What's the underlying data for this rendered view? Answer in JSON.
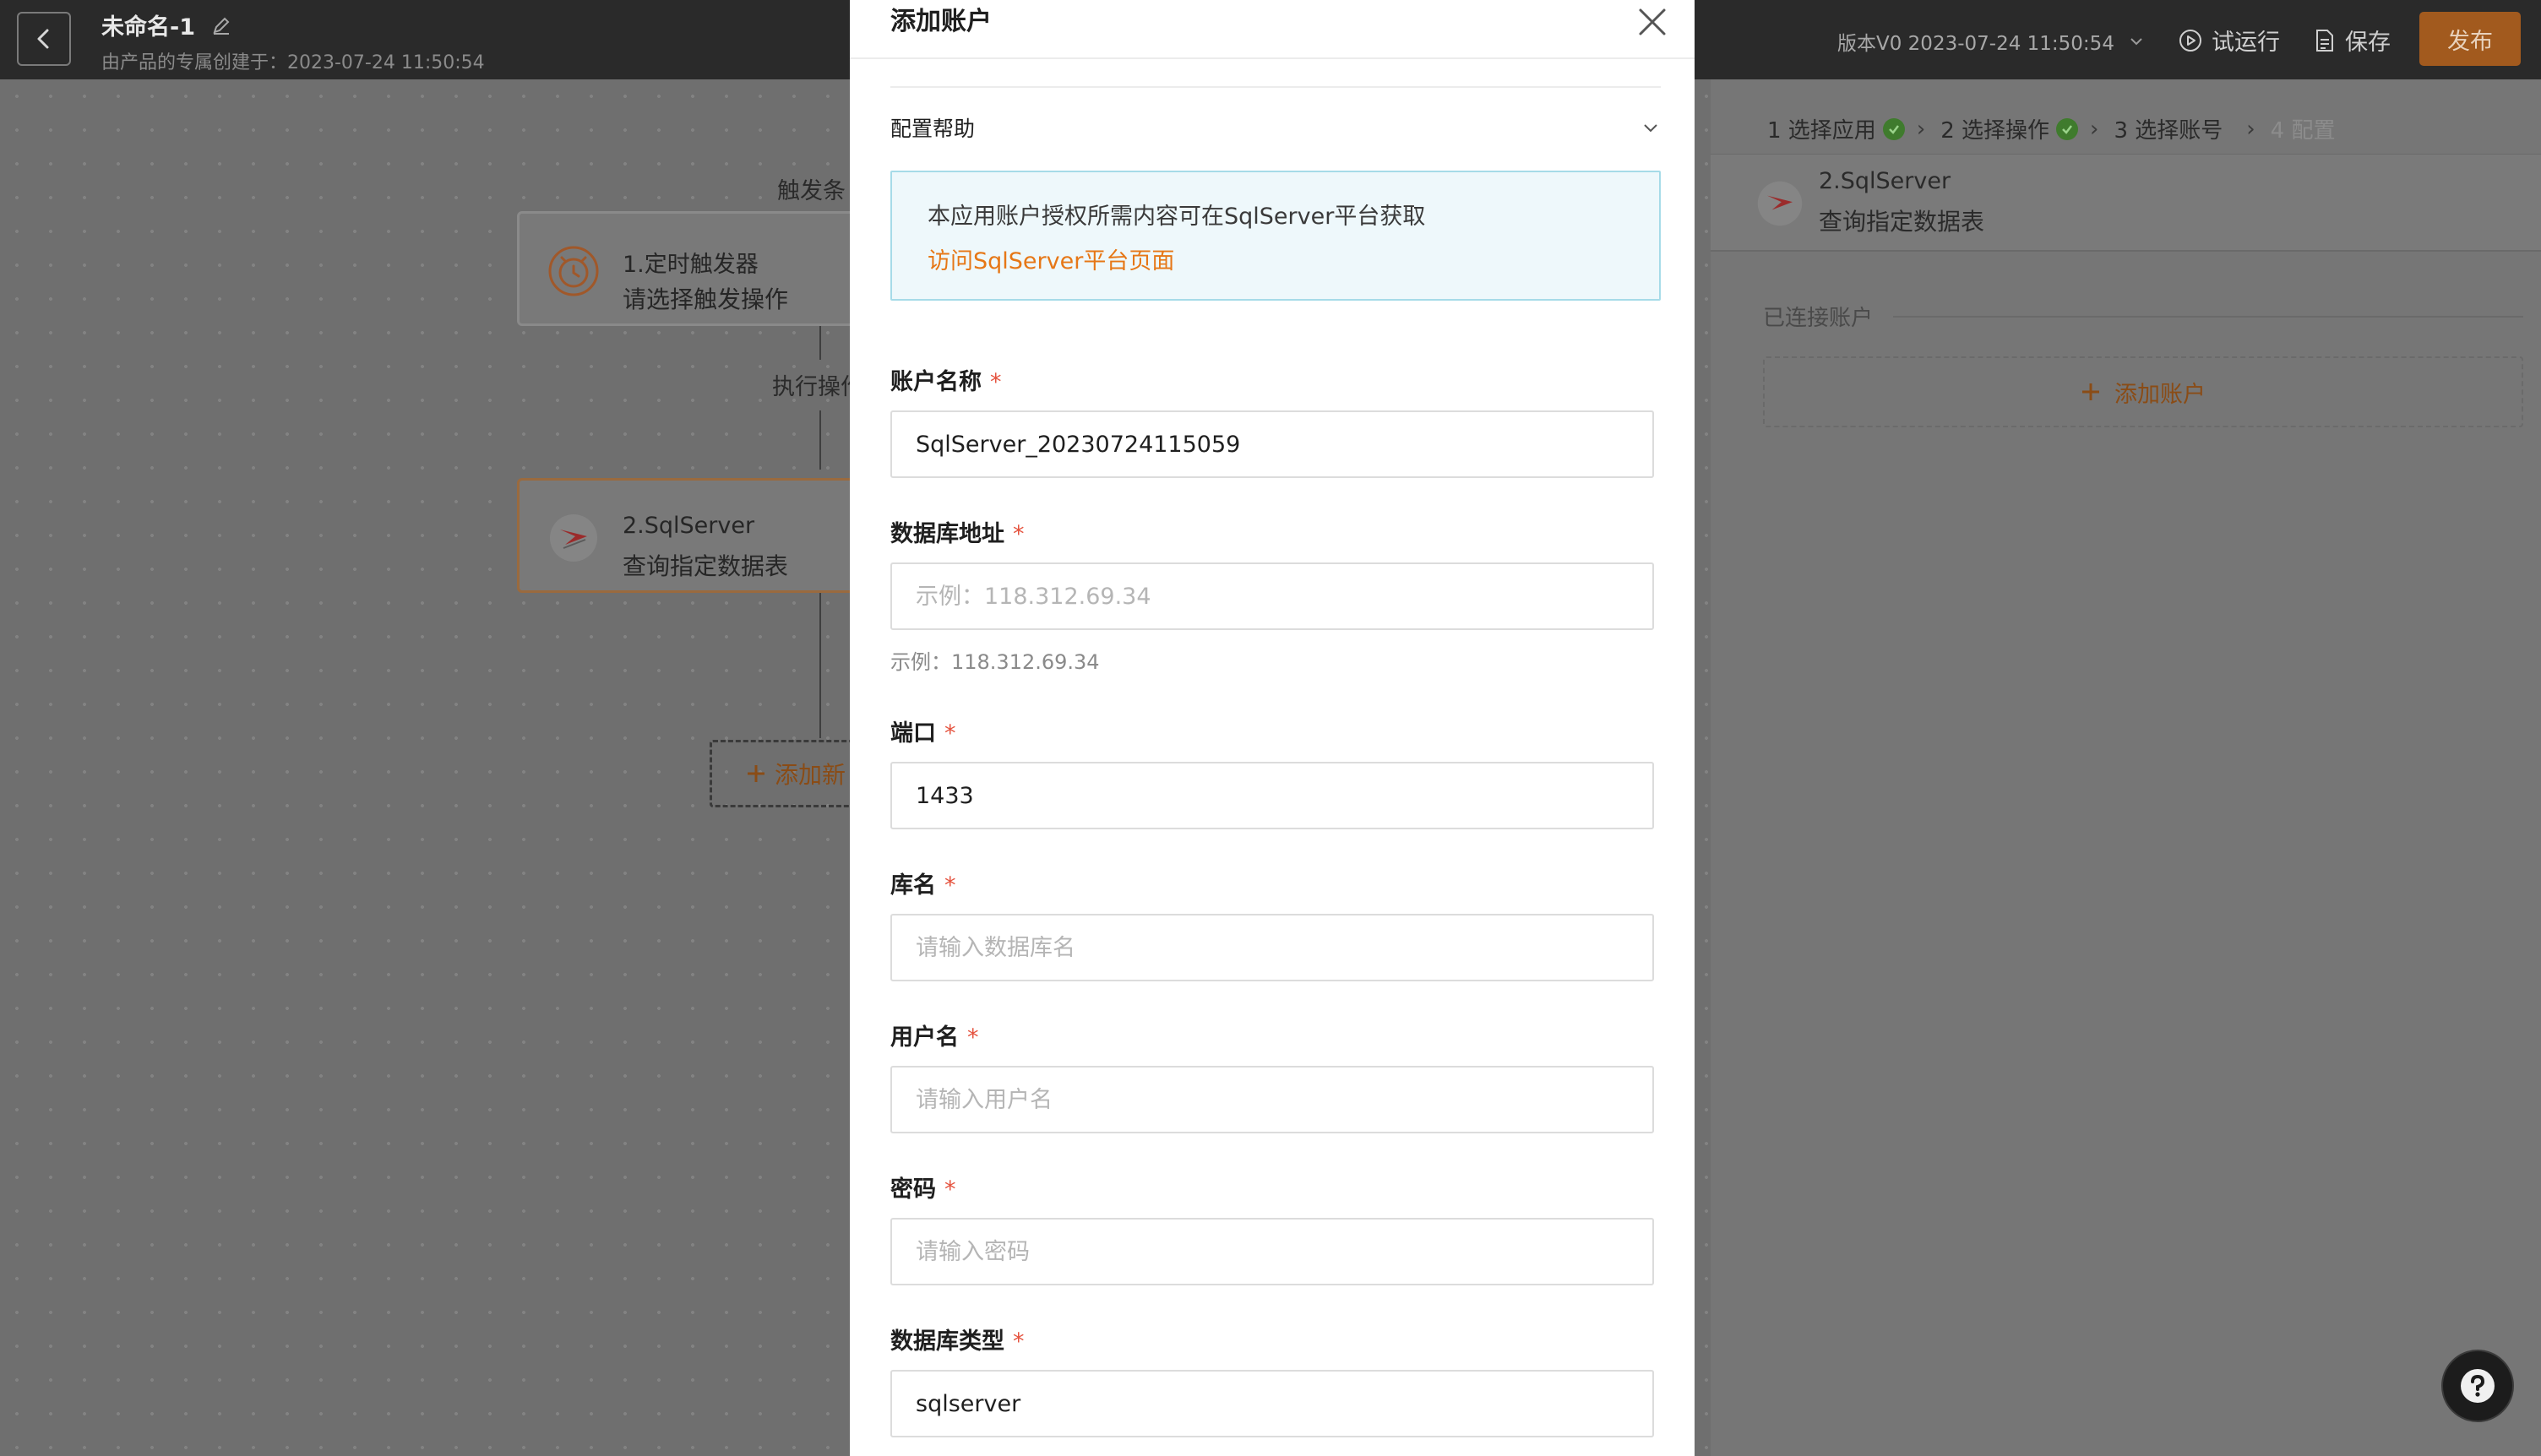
{
  "header": {
    "title": "未命名-1",
    "subtitle": "由产品的专属创建于：2023-07-24 11:50:54",
    "version": "版本V0 2023-07-24 11:50:54",
    "actions": {
      "test_run": "试运行",
      "save": "保存",
      "publish": "发布"
    }
  },
  "canvas": {
    "trigger_label": "触发条",
    "action_label": "执行操作",
    "nodes": [
      {
        "title": "1.定时触发器",
        "subtitle": "请选择触发操作"
      },
      {
        "title": "2.SqlServer",
        "subtitle": "查询指定数据表"
      }
    ],
    "add_new": "添加新"
  },
  "right_panel": {
    "steps": [
      {
        "label": "1 选择应用",
        "status": "done"
      },
      {
        "label": "2 选择操作",
        "status": "done"
      },
      {
        "label": "3 选择账号",
        "status": "current"
      },
      {
        "label": "4 配置",
        "status": "disabled"
      }
    ],
    "card": {
      "title": "2.SqlServer",
      "subtitle": "查询指定数据表"
    },
    "connected_label": "已连接账户",
    "add_account": "添加账户"
  },
  "modal": {
    "title": "添加账户",
    "help_title": "配置帮助",
    "help_text": "本应用账户授权所需内容可在SqlServer平台获取",
    "help_link": "访问SqlServer平台页面",
    "fields": {
      "account_name": {
        "label": "账户名称",
        "value": "SqlServer_20230724115059",
        "placeholder": ""
      },
      "db_address": {
        "label": "数据库地址",
        "value": "",
        "placeholder": "示例：118.312.69.34",
        "hint": "示例：118.312.69.34"
      },
      "port": {
        "label": "端口",
        "value": "1433",
        "placeholder": ""
      },
      "db_name": {
        "label": "库名",
        "value": "",
        "placeholder": "请输入数据库名"
      },
      "username": {
        "label": "用户名",
        "value": "",
        "placeholder": "请输入用户名"
      },
      "password": {
        "label": "密码",
        "value": "",
        "placeholder": "请输入密码"
      },
      "db_type": {
        "label": "数据库类型",
        "value": "sqlserver",
        "placeholder": ""
      }
    },
    "required_mark": "*"
  },
  "colors": {
    "accent": "#e67716",
    "required": "#e5533f",
    "overlay": "#6f6f6f",
    "topbar": "#2a2a2a"
  }
}
